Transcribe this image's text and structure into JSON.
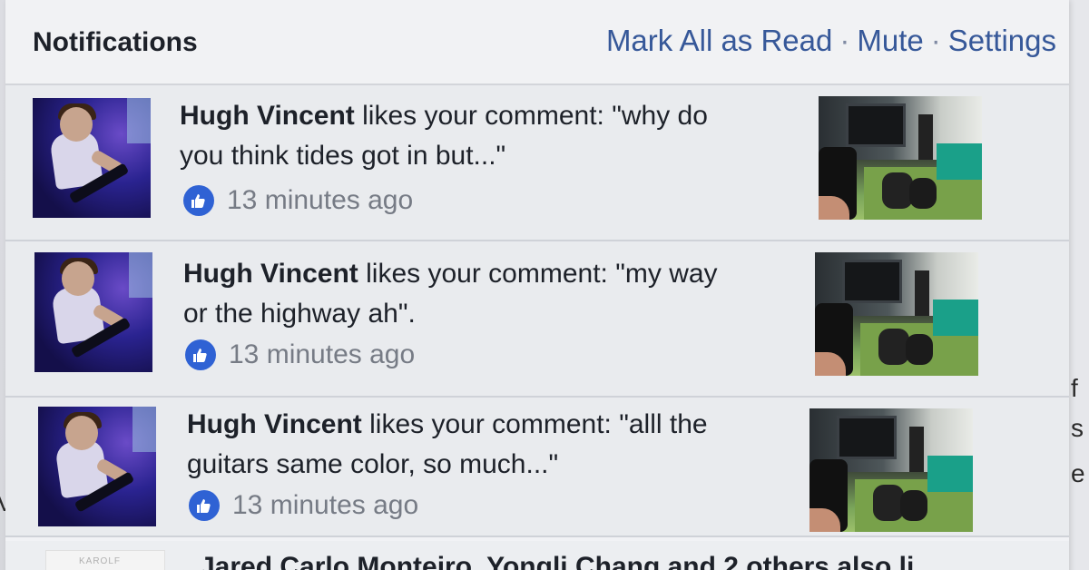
{
  "header": {
    "title": "Notifications",
    "actions": {
      "mark_all": "Mark All as Read",
      "sep1": "·",
      "mute": "Mute",
      "sep2": "·",
      "settings": "Settings"
    }
  },
  "notifications": [
    {
      "user": "Hugh Vincent",
      "line1": " likes your comment: \"why do",
      "line2": "you think tides got in but...\"",
      "time": "13 minutes ago"
    },
    {
      "user": "Hugh Vincent",
      "line1": " likes your comment: \"my way",
      "line2": "or the highway ah\".",
      "time": "13 minutes ago"
    },
    {
      "user": "Hugh Vincent",
      "line1": " likes your comment: \"alll the",
      "line2": "guitars same color, so much...\"",
      "time": "13 minutes ago"
    }
  ],
  "partial": {
    "text": "Jared Carlo Monteiro, Yongli Chang and 2 others also li",
    "avatar_text": "KAROLF"
  },
  "edge": {
    "letters": [
      "f",
      "s",
      "e"
    ],
    "left_letter": "V"
  },
  "colors": {
    "link": "#365899",
    "like_badge": "#2f62d4",
    "panel_bg": "#f1f2f5"
  }
}
